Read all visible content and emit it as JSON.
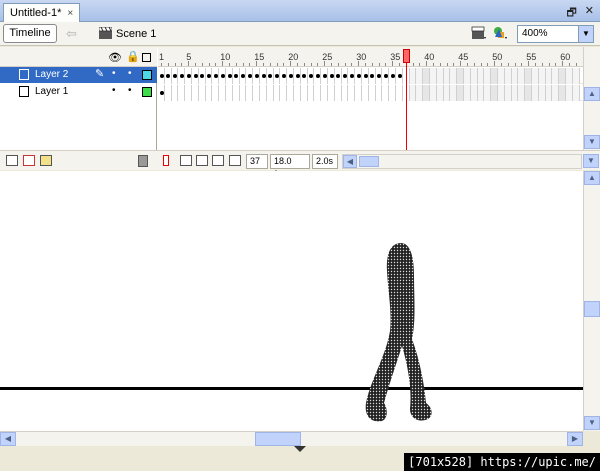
{
  "document": {
    "tab_title": "Untitled-1*",
    "close_glyph": "×"
  },
  "window_controls": {
    "restore": "🗗",
    "close": "✕"
  },
  "editbar": {
    "timeline_button": "Timeline",
    "scene_label": "Scene 1",
    "zoom_value": "400%"
  },
  "timeline": {
    "ruler_labels": [
      "1",
      "5",
      "10",
      "15",
      "20",
      "25",
      "30",
      "35",
      "40",
      "45",
      "50",
      "55",
      "60"
    ],
    "layers": [
      {
        "name": "Layer 2",
        "selected": true,
        "color": "#4dd8e8"
      },
      {
        "name": "Layer 1",
        "selected": false,
        "color": "#3ddc4b"
      }
    ],
    "current_frame": "37",
    "frame_rate": "18.0 fps",
    "elapsed_time": "2.0s"
  },
  "watermark": "[701x528] https://upic.me/",
  "colors": {
    "selection": "#316ac5",
    "playhead": "#ff6666",
    "scroll_button": "#c1d3fb"
  }
}
